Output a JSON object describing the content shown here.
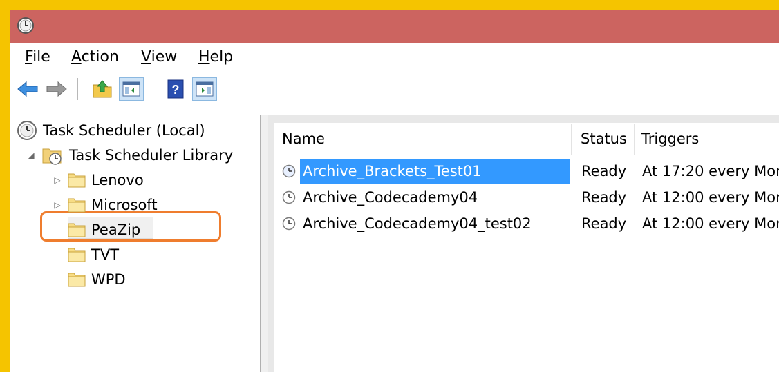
{
  "window": {
    "icon": "clock-icon",
    "title_bar_color": "#cc6460",
    "frame_color": "#f5c400"
  },
  "menubar": {
    "items": [
      {
        "key": "F",
        "rest": "ile"
      },
      {
        "key": "A",
        "rest": "ction"
      },
      {
        "key": "V",
        "rest": "iew"
      },
      {
        "key": "H",
        "rest": "elp"
      }
    ]
  },
  "toolbar": {
    "buttons": [
      "back-arrow-icon",
      "forward-arrow-icon",
      "up-folder-icon",
      "show-hide-console-tree-icon",
      "help-icon",
      "show-hide-action-pane-icon"
    ]
  },
  "tree": {
    "root": "Task Scheduler (Local)",
    "library": "Task Scheduler Library",
    "folders": [
      "Lenovo",
      "Microsoft",
      "PeaZip",
      "TVT",
      "WPD"
    ],
    "highlight_color": "#ef7d2e"
  },
  "list": {
    "columns": [
      "Name",
      "Status",
      "Triggers"
    ],
    "rows": [
      {
        "name": "Archive_Brackets_Test01",
        "status": "Ready",
        "trigger": "At 17:20 every Mon"
      },
      {
        "name": "Archive_Codecademy04",
        "status": "Ready",
        "trigger": "At 12:00 every Mon"
      },
      {
        "name": "Archive_Codecademy04_test02",
        "status": "Ready",
        "trigger": "At 12:00 every Mon"
      }
    ],
    "selection_color": "#3399ff"
  }
}
